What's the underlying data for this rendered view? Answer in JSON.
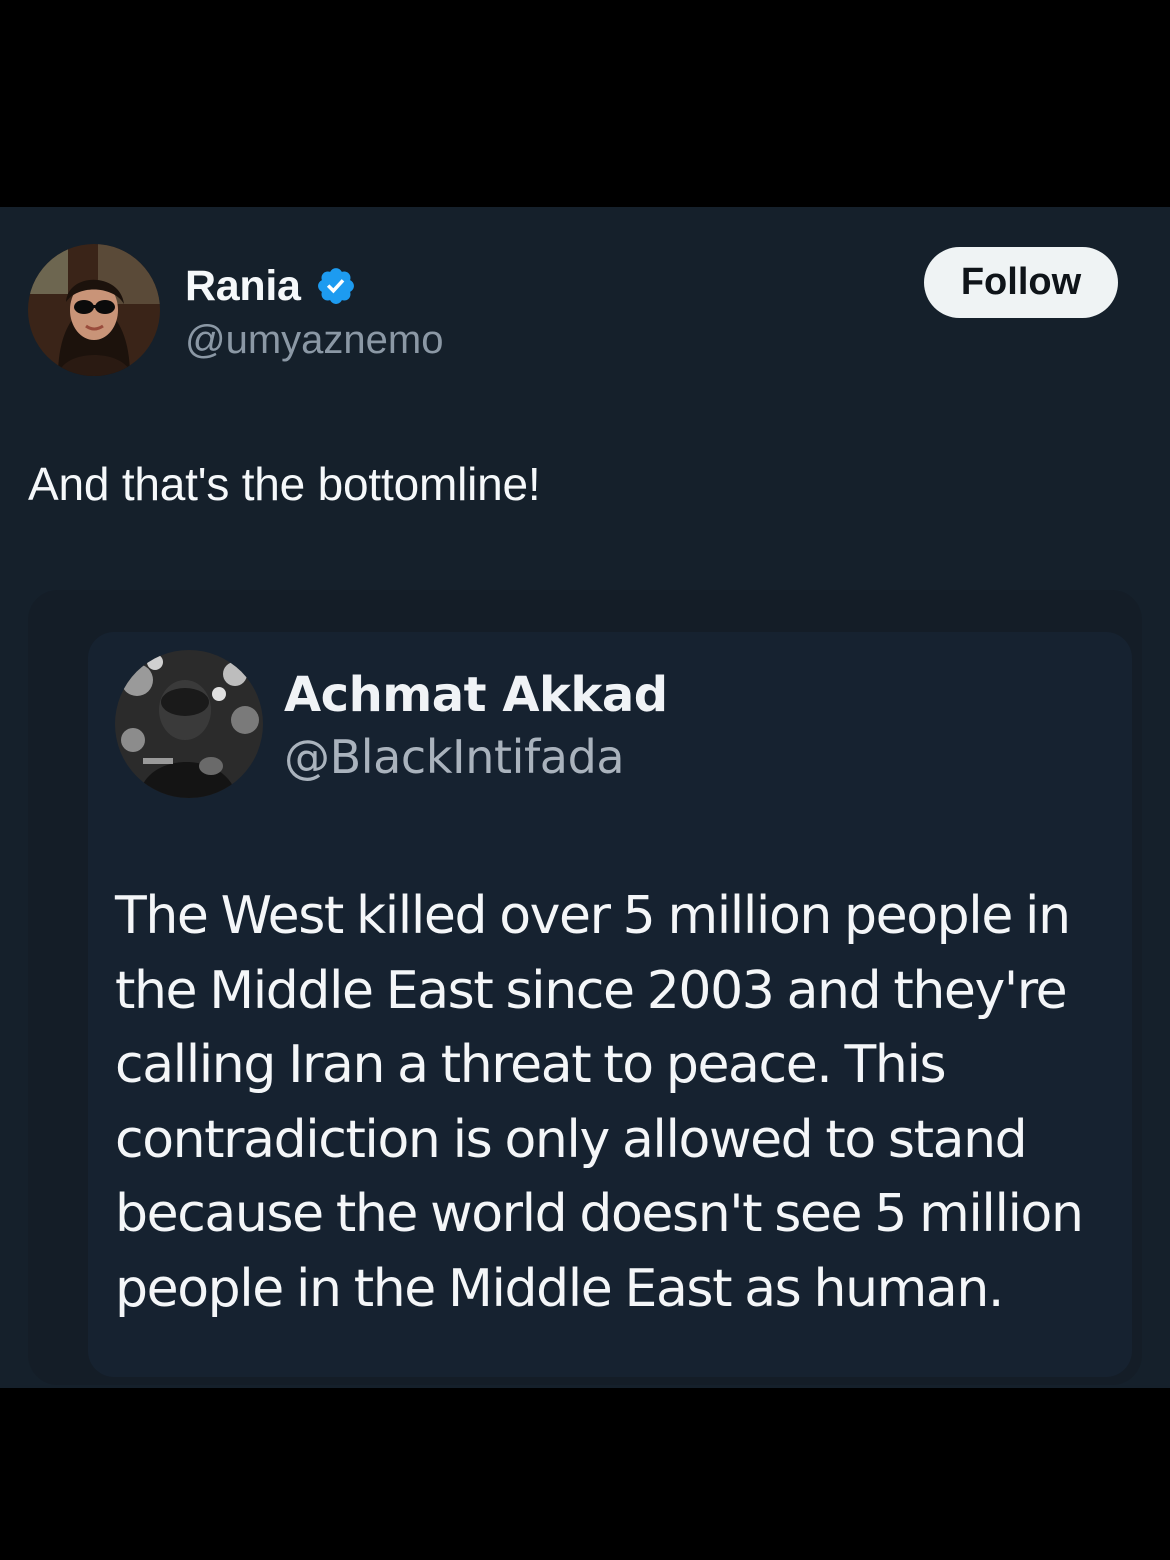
{
  "post": {
    "author": {
      "display_name": "Rania",
      "handle": "@umyaznemo",
      "verified": true,
      "verified_color": "#1d9bf0"
    },
    "follow_label": "Follow",
    "text": "And that's the bottomline!"
  },
  "quoted_post": {
    "author": {
      "display_name": "Achmat Akkad",
      "handle": "@BlackIntifada"
    },
    "text": "The West killed over 5 million people in the Middle East since 2003 and they're calling Iran a threat to peace. This contradiction is only allowed to stand because the world doesn't see 5 million people in the Middle East as human."
  },
  "colors": {
    "background": "#15202b",
    "letterbox": "#000000",
    "text_primary": "#f5f8fa",
    "text_secondary": "#8b98a5",
    "follow_button_bg": "#eff3f4"
  }
}
